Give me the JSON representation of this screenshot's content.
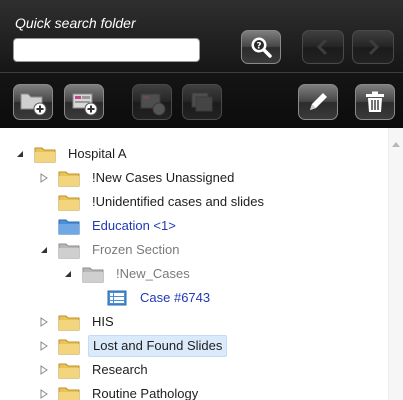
{
  "search": {
    "label": "Quick search folder",
    "value": "",
    "placeholder": ""
  },
  "toolbar_buttons": {
    "search": "search-icon",
    "prev": "chevron-left-icon",
    "next": "chevron-right-icon",
    "new_folder": "folder-add-icon",
    "new_case": "case-add-icon",
    "disabled_a": "case-move-icon",
    "disabled_b": "case-copy-icon",
    "edit": "pencil-icon",
    "delete": "trash-icon"
  },
  "tree": {
    "items": [
      {
        "label": "Hospital A",
        "expanded": true
      },
      {
        "label": "!New Cases Unassigned"
      },
      {
        "label": "!Unidentified cases and slides"
      },
      {
        "label": "Education <1>"
      },
      {
        "label": "Frozen Section",
        "expanded": true
      },
      {
        "label": "!New_Cases",
        "expanded": true
      },
      {
        "label": "Case #6743"
      },
      {
        "label": "HIS"
      },
      {
        "label": "Lost and Found Slides",
        "selected": true
      },
      {
        "label": "Research"
      },
      {
        "label": "Routine Pathology"
      }
    ]
  },
  "colors": {
    "folder_yellow": "#e9c25b",
    "folder_blue": "#4b8fd6",
    "folder_gray": "#b7b7b7",
    "link_blue": "#1f39b8",
    "selection": "#dbeafa"
  }
}
